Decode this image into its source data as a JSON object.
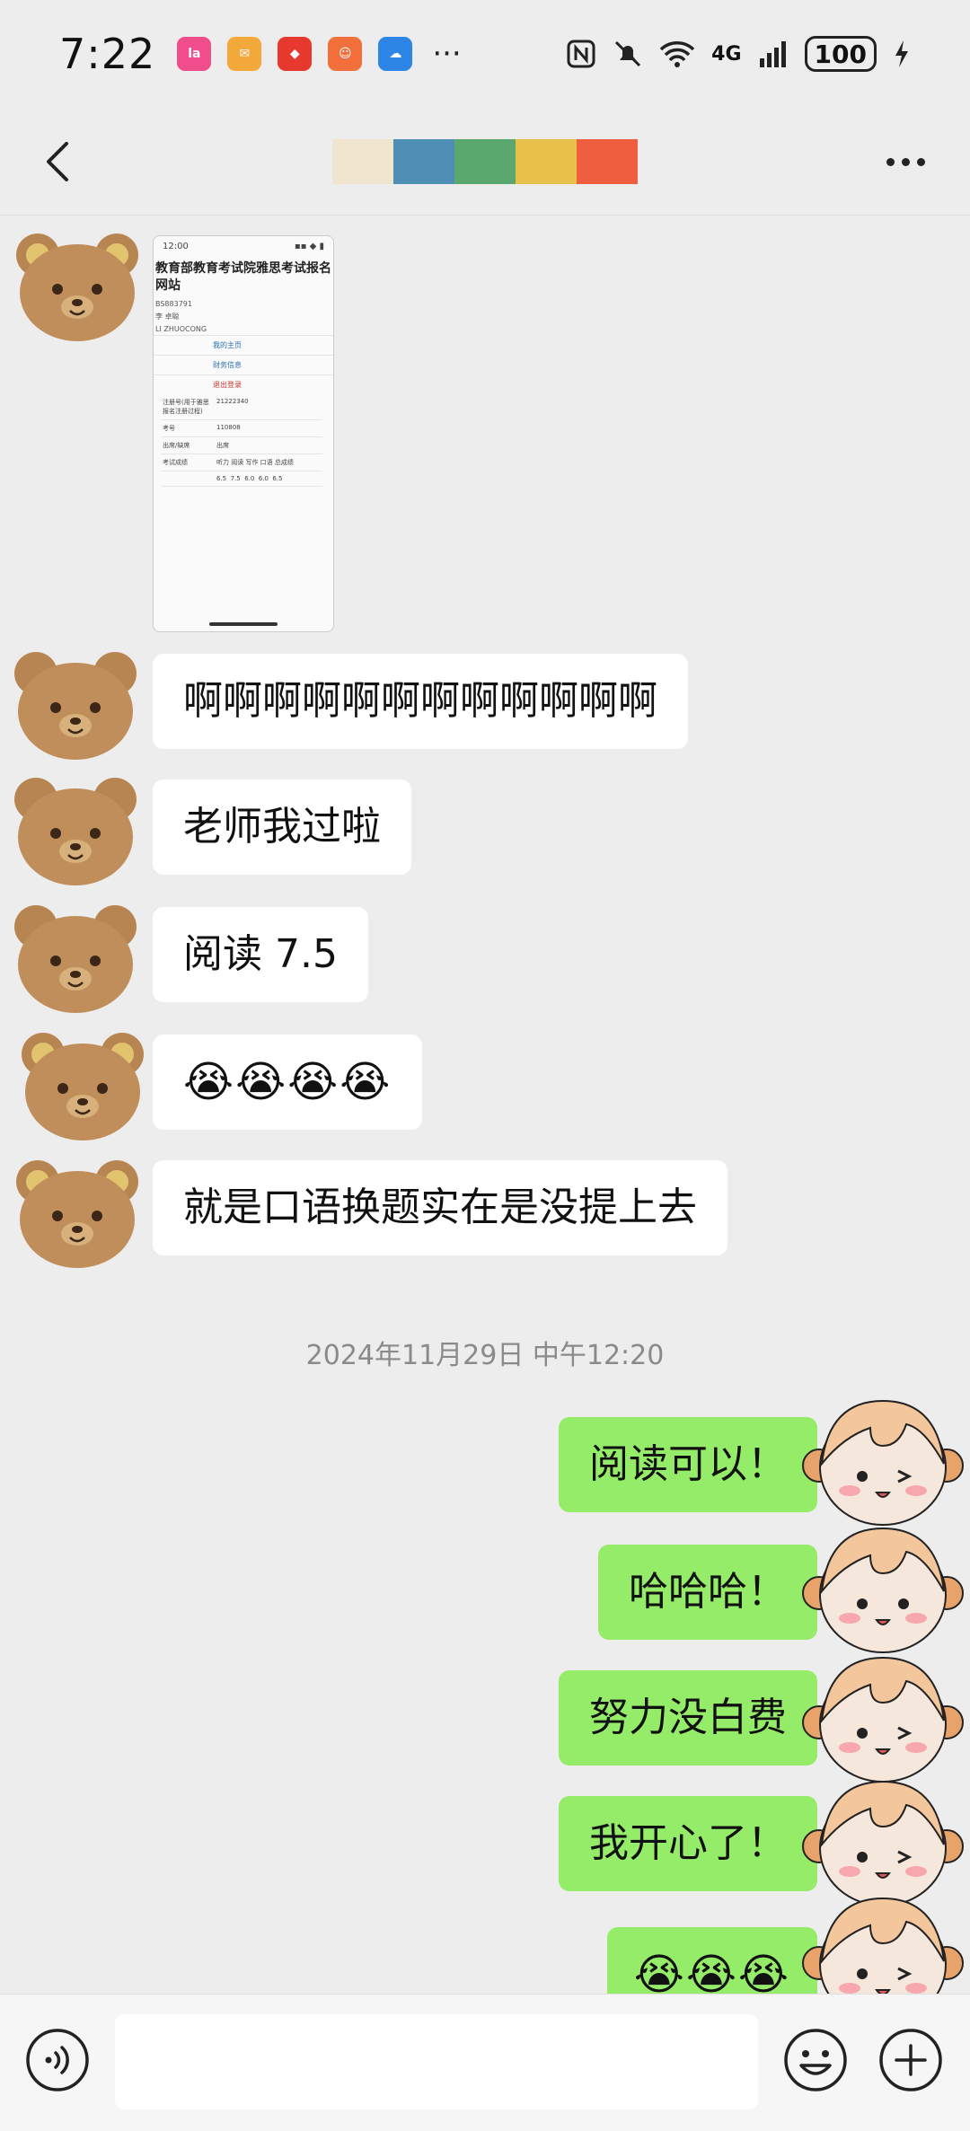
{
  "status_bar": {
    "time": "7:22",
    "app_icons": [
      "lala-icon",
      "bird-app-icon",
      "huawei-store-icon",
      "app-store-icon",
      "weather-icon"
    ],
    "overflow": "···",
    "network": "4G",
    "battery": "100"
  },
  "header": {
    "title_blocks": [
      "#f0e6cf",
      "#4f8fb6",
      "#5aa86e",
      "#e8c04a",
      "#ef5f3d"
    ]
  },
  "image_message": {
    "status_time": "12:00",
    "title": "教育部教育考试院雅思考试报名网站",
    "lines": [
      "BS883791",
      "李 卓聪",
      "LI ZHUOCONG"
    ],
    "links": [
      "我的主页",
      "财务信息",
      "退出登录"
    ],
    "rows": [
      {
        "label": "注册号(用于雅思报名注册过程)",
        "value": "21222340"
      },
      {
        "label": "考号",
        "value": "110808"
      },
      {
        "label": "出席/缺席",
        "value": "出席"
      },
      {
        "label": "考试成绩",
        "value": "听力 阅读 写作 口语 总成绩"
      }
    ],
    "scores": [
      "6.5",
      "7.5",
      "6.0",
      "6.0",
      "6.5"
    ]
  },
  "messages_received": [
    {
      "text": "啊啊啊啊啊啊啊啊啊啊啊啊"
    },
    {
      "text": "老师我过啦"
    },
    {
      "text": "阅读 7.5"
    },
    {
      "text": "😭😭😭😭"
    },
    {
      "text": "就是口语换题实在是没提上去"
    }
  ],
  "timestamp": "2024年11月29日 中午12:20",
  "messages_sent": [
    {
      "text": "阅读可以！"
    },
    {
      "text": "哈哈哈！"
    },
    {
      "text": "努力没白费"
    },
    {
      "text": "我开心了！"
    },
    {
      "text": "😭😭😭"
    }
  ],
  "input_bar": {
    "placeholder": ""
  }
}
